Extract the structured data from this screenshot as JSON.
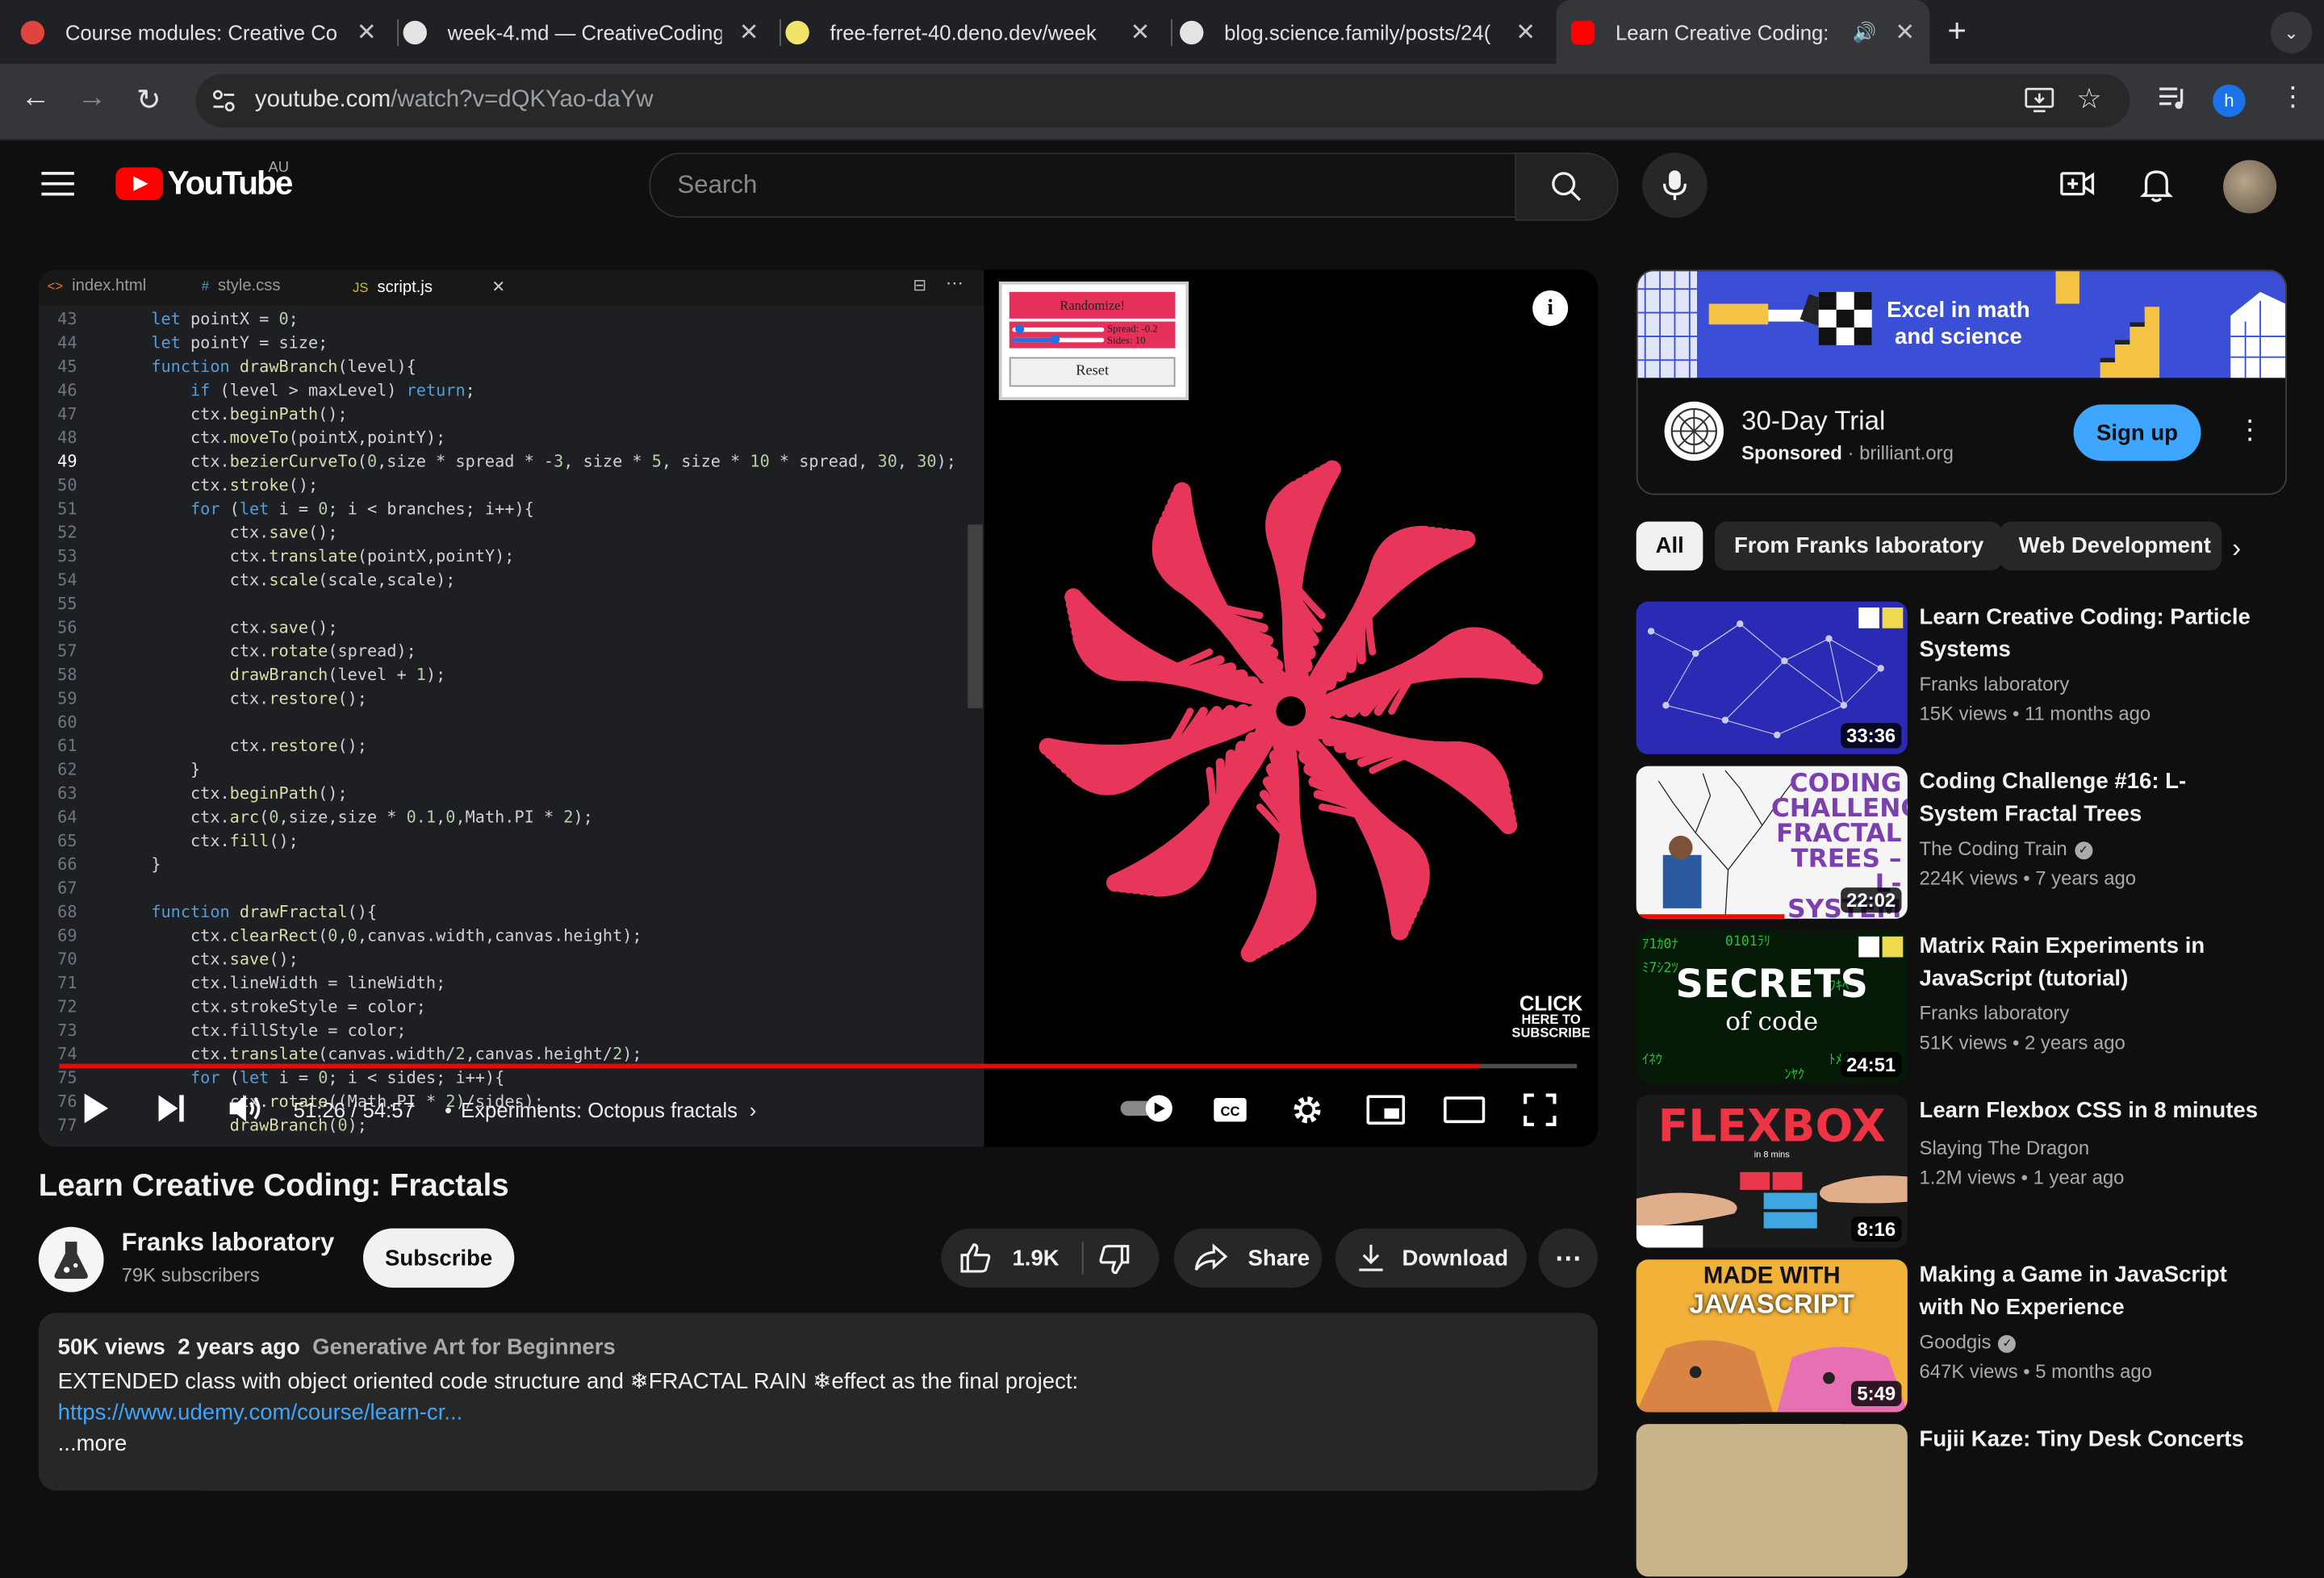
{
  "browser": {
    "tabs": [
      {
        "title": "Course modules: Creative Co",
        "active": false
      },
      {
        "title": "week-4.md — CreativeCoding",
        "active": false
      },
      {
        "title": "free-ferret-40.deno.dev/week",
        "active": false
      },
      {
        "title": "blog.science.family/posts/24(",
        "active": false
      },
      {
        "title": "Learn Creative Coding: Fr",
        "active": true
      }
    ],
    "url_host": "youtube.com",
    "url_path": "/watch?v=dQKYao-daYw",
    "profile_initial": "h"
  },
  "yt": {
    "logo_text": "YouTube",
    "region": "AU",
    "search_placeholder": "Search"
  },
  "player": {
    "editor_tabs": [
      "index.html",
      "style.css",
      "script.js"
    ],
    "editor_tab_langs": [
      "<>",
      "#",
      "JS"
    ],
    "code_lines": [
      {
        "n": "43",
        "t": "let pointX = 0;"
      },
      {
        "n": "44",
        "t": "let pointY = size;"
      },
      {
        "n": "45",
        "t": "function drawBranch(level){"
      },
      {
        "n": "46",
        "t": "    if (level > maxLevel) return;"
      },
      {
        "n": "47",
        "t": "    ctx.beginPath();"
      },
      {
        "n": "48",
        "t": "    ctx.moveTo(pointX,pointY);"
      },
      {
        "n": "49",
        "t": "    ctx.bezierCurveTo(0,size * spread * -3, size * 5, size * 10 * spread, 30, 30);"
      },
      {
        "n": "50",
        "t": "    ctx.stroke();"
      },
      {
        "n": "51",
        "t": "    for (let i = 0; i < branches; i++){"
      },
      {
        "n": "52",
        "t": "        ctx.save();"
      },
      {
        "n": "53",
        "t": "        ctx.translate(pointX,pointY);"
      },
      {
        "n": "54",
        "t": "        ctx.scale(scale,scale);"
      },
      {
        "n": "55",
        "t": ""
      },
      {
        "n": "56",
        "t": "        ctx.save();"
      },
      {
        "n": "57",
        "t": "        ctx.rotate(spread);"
      },
      {
        "n": "58",
        "t": "        drawBranch(level + 1);"
      },
      {
        "n": "59",
        "t": "        ctx.restore();"
      },
      {
        "n": "60",
        "t": ""
      },
      {
        "n": "61",
        "t": "        ctx.restore();"
      },
      {
        "n": "62",
        "t": "    }"
      },
      {
        "n": "63",
        "t": "    ctx.beginPath();"
      },
      {
        "n": "64",
        "t": "    ctx.arc(0,size,size * 0.1,0,Math.PI * 2);"
      },
      {
        "n": "65",
        "t": "    ctx.fill();"
      },
      {
        "n": "66",
        "t": "}"
      },
      {
        "n": "67",
        "t": ""
      },
      {
        "n": "68",
        "t": "function drawFractal(){"
      },
      {
        "n": "69",
        "t": "    ctx.clearRect(0,0,canvas.width,canvas.height);"
      },
      {
        "n": "70",
        "t": "    ctx.save();"
      },
      {
        "n": "71",
        "t": "    ctx.lineWidth = lineWidth;"
      },
      {
        "n": "72",
        "t": "    ctx.strokeStyle = color;"
      },
      {
        "n": "73",
        "t": "    ctx.fillStyle = color;"
      },
      {
        "n": "74",
        "t": "    ctx.translate(canvas.width/2,canvas.height/2);"
      },
      {
        "n": "75",
        "t": "    for (let i = 0; i < sides; i++){"
      },
      {
        "n": "76",
        "t": "        ctx.rotate((Math.PI * 2)/sides);"
      },
      {
        "n": "77",
        "t": "        drawBranch(0);"
      }
    ],
    "demo": {
      "randomize_label": "Randomize!",
      "spread_label": "Spread: -0.2",
      "sides_label": "Sides: 10",
      "reset_label": "Reset"
    },
    "watermark": {
      "line1": "CLICK",
      "line2": "HERE TO",
      "line3": "SUBSCRIBE"
    },
    "time_current": "51:26",
    "time_total": "54:57",
    "time_display": "51:26 / 54:57",
    "chapter": "Experiments: Octopus fractals",
    "progress_fraction": 0.936
  },
  "video": {
    "title": "Learn Creative Coding: Fractals",
    "channel": "Franks laboratory",
    "subscribers": "79K subscribers",
    "subscribe_label": "Subscribe",
    "likes": "1.9K",
    "share_label": "Share",
    "download_label": "Download"
  },
  "description": {
    "views": "50K views",
    "age": "2 years ago",
    "tag": "Generative Art for Beginners",
    "line1": "EXTENDED class with object oriented code structure and ❄FRACTAL RAIN ❄effect as the final project:",
    "link": "https://www.udemy.com/course/learn-cr...",
    "more": "...more"
  },
  "ad": {
    "banner_text_1": "Excel in math",
    "banner_text_2": "and science",
    "title": "30-Day Trial",
    "sponsored": "Sponsored",
    "domain": "brilliant.org",
    "cta": "Sign up"
  },
  "chips": [
    "All",
    "From Franks laboratory",
    "Web Development"
  ],
  "recommendations": [
    {
      "title": "Learn Creative Coding: Particle Systems",
      "channel": "Franks laboratory",
      "meta": "15K views • 11 months ago",
      "duration": "33:36",
      "verified": false
    },
    {
      "title": "Coding Challenge #16: L-System Fractal Trees",
      "channel": "The Coding Train",
      "meta": "224K views • 7 years ago",
      "duration": "22:02",
      "verified": true,
      "thumb_text": "CODING CHALLENGE: FRACTAL TREES – L-SYSTEM"
    },
    {
      "title": "Matrix Rain Experiments in JavaScript (tutorial)",
      "channel": "Franks laboratory",
      "meta": "51K views • 2 years ago",
      "duration": "24:51",
      "verified": false,
      "thumb_text_1": "SECRETS",
      "thumb_text_2": "of code"
    },
    {
      "title": "Learn Flexbox CSS in 8 minutes",
      "channel": "Slaying The Dragon",
      "meta": "1.2M views • 1 year ago",
      "duration": "8:16",
      "verified": false,
      "thumb_text_1": "FLEXBOX",
      "thumb_text_2": "in 8 mins"
    },
    {
      "title": "Making a Game in JavaScript with No Experience",
      "channel": "Goodgis",
      "meta": "647K views • 5 months ago",
      "duration": "5:49",
      "verified": true,
      "thumb_text_1": "MADE WITH",
      "thumb_text_2": "JAVASCRIPT"
    },
    {
      "title": "Fujii Kaze: Tiny Desk Concerts",
      "channel": "",
      "meta": "",
      "duration": "",
      "verified": false
    }
  ],
  "colors": {
    "yt_red": "#ff0000",
    "fractal_pink": "#e8355a",
    "link_blue": "#3ea6ff"
  }
}
